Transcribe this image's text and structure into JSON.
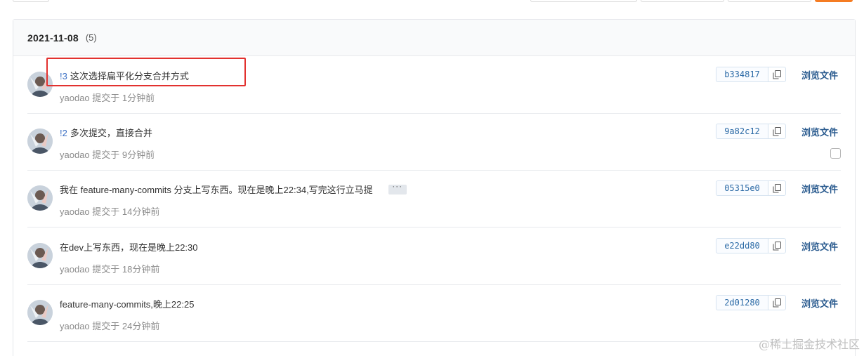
{
  "group": {
    "date": "2021-11-08",
    "count": "(5)"
  },
  "commits": [
    {
      "ref": "!3",
      "message": "这次选择扁平化分支合并方式",
      "author": "yaodao",
      "action": "提交于",
      "time": "1分钟前",
      "sha": "b334817",
      "browse_label": "浏览文件"
    },
    {
      "ref": "!2",
      "message": "多次提交，直接合并",
      "author": "yaodao",
      "action": "提交于",
      "time": "9分钟前",
      "sha": "9a82c12",
      "browse_label": "浏览文件"
    },
    {
      "ref": "",
      "message": "我在 feature-many-commits 分支上写东西。现在是晚上22:34,写完这行立马提",
      "more_label": "···",
      "author": "yaodao",
      "action": "提交于",
      "time": "14分钟前",
      "sha": "05315e0",
      "browse_label": "浏览文件"
    },
    {
      "ref": "",
      "message": "在dev上写东西，现在是晚上22:30",
      "author": "yaodao",
      "action": "提交于",
      "time": "18分钟前",
      "sha": "e22dd80",
      "browse_label": "浏览文件"
    },
    {
      "ref": "",
      "message": "feature-many-commits,晚上22:25",
      "author": "yaodao",
      "action": "提交于",
      "time": "24分钟前",
      "sha": "2d01280",
      "browse_label": "浏览文件"
    }
  ],
  "icons": {
    "copy": "copy-icon",
    "avatar": "avatar-image"
  },
  "colors": {
    "highlight": "#e2312f",
    "sha_text": "#2b6aa6",
    "accent_button": "#f57c23"
  },
  "watermark": "@稀土掘金技术社区"
}
